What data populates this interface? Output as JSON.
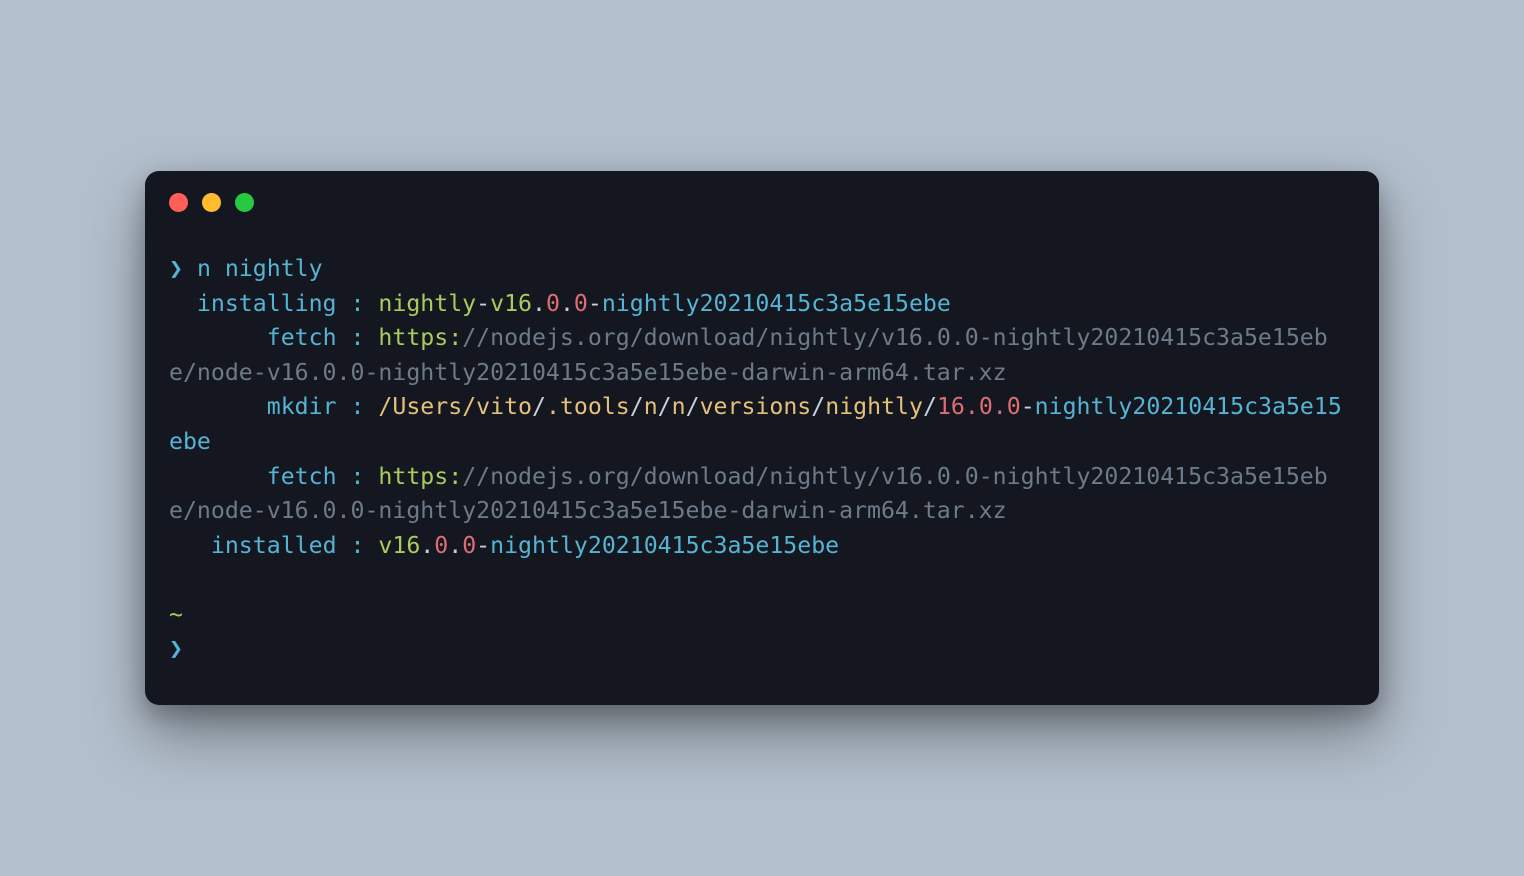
{
  "traffic": {
    "close": "close",
    "min": "minimize",
    "max": "maximize"
  },
  "command": "n nightly",
  "lines": {
    "install_label": "  installing :",
    "install_name1": " nightly",
    "install_dash1": "-",
    "install_v": "v16",
    "dot": ".",
    "zero": "0",
    "install_dash2": "-",
    "install_rest": "nightly20210415c3a5e15ebe",
    "fetch1_label": "       fetch :",
    "fetch1_proto": " https:",
    "fetch1_url": "//nodejs.org/download/nightly/v16.0.0-nightly20210415c3a5e15ebe/node-v16.0.0-nightly20210415c3a5e15ebe-darwin-arm64.tar.xz",
    "mkdir_label": "       mkdir :",
    "mkdir_p1": " /Users/vito",
    "mkdir_s1": "/",
    "mkdir_p2": ".tools",
    "mkdir_s2": "/",
    "mkdir_p3": "n",
    "mkdir_s3": "/",
    "mkdir_p4": "n",
    "mkdir_s4": "/",
    "mkdir_p5": "versions",
    "mkdir_s5": "/",
    "mkdir_p6": "nightly",
    "mkdir_s6": "/",
    "mkdir_ver": "16.0.0",
    "mkdir_dash": "-",
    "mkdir_rest": "nightly20210415c3a5e15ebe",
    "fetch2_label": "       fetch :",
    "fetch2_proto": " https:",
    "fetch2_url": "//nodejs.org/download/nightly/v16.0.0-nightly20210415c3a5e15ebe/node-v16.0.0-nightly20210415c3a5e15ebe-darwin-arm64.tar.xz",
    "done_label": "   installed :",
    "done_v": " v16",
    "done_dash": "-",
    "done_rest": "nightly20210415c3a5e15ebe",
    "tilde": "~",
    "prompt_glyph": "❯"
  }
}
